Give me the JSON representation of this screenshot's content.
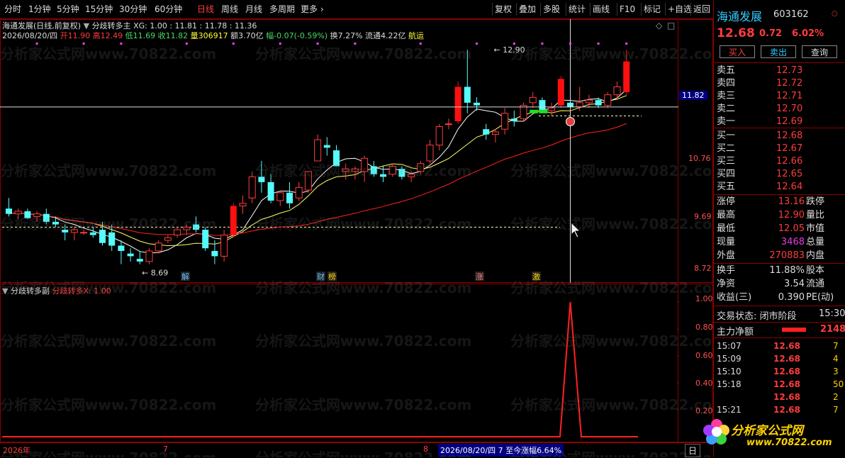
{
  "toolbar": {
    "left_items": [
      "分时",
      "1分钟",
      "5分钟",
      "15分钟",
      "30分钟",
      "60分钟",
      "日线",
      "周线",
      "月线",
      "多周期",
      "更多 ›"
    ],
    "active_index": 6,
    "right_items": [
      "复权",
      "叠加",
      "多股",
      "统计",
      "画线",
      "F10",
      "标记",
      "+自选",
      "返回"
    ]
  },
  "main_panel": {
    "stock_line": "海通发展(日线,前复权)",
    "indicator_name": "分歧转多主",
    "xg": "XG: 1.00 : 11.81 : 11.78 : 11.36",
    "detail_date": "2026/08/20/四",
    "detail_open": "开11.90",
    "detail_high": "高12.49",
    "detail_low": "低11.69",
    "detail_close": "收11.82",
    "detail_vol": "量306917",
    "detail_amt": "额3.70亿",
    "detail_chg": "幅-0.07(-0.59%)",
    "detail_turn": "换7.27%",
    "detail_float": "流通4.22亿",
    "detail_sector": "航运",
    "y_labels": [
      "11.82",
      "10.76",
      "9.69",
      "8.72"
    ],
    "high_mark": "12.90",
    "low_mark": "8.69",
    "event_tags": [
      "解",
      "财",
      "榜",
      "涨",
      "激"
    ]
  },
  "sub_panel": {
    "title": "分歧转多副",
    "value": "分歧转多X: 1.00",
    "y_labels": [
      "1.00",
      "0.80",
      "0.60",
      "0.40",
      "0.20"
    ]
  },
  "bottom_bar": {
    "year": "2026年",
    "m7": "7",
    "m8": "8",
    "status": "2026/08/20/四 7 至今涨幅6.64%",
    "period": "日"
  },
  "watermark": "分析家公式网www.70822.com",
  "right_panel": {
    "name": "海通发展",
    "code": "603162",
    "price": "12.68",
    "change": "0.72",
    "pct": "6.02%",
    "buy_btn": "买入",
    "sell_btn": "卖出",
    "query_btn": "查询",
    "asks": [
      [
        "卖五",
        "12.73"
      ],
      [
        "卖四",
        "12.72"
      ],
      [
        "卖三",
        "12.71"
      ],
      [
        "卖二",
        "12.70"
      ],
      [
        "卖一",
        "12.69"
      ]
    ],
    "bids": [
      [
        "买一",
        "12.68"
      ],
      [
        "买二",
        "12.67"
      ],
      [
        "买三",
        "12.66"
      ],
      [
        "买四",
        "12.65"
      ],
      [
        "买五",
        "12.64"
      ]
    ],
    "stats": [
      [
        "涨停",
        "13.16",
        "跌停"
      ],
      [
        "最高",
        "12.90",
        "量比"
      ],
      [
        "最低",
        "12.05",
        "市值"
      ],
      [
        "现量",
        "3468",
        "总量"
      ],
      [
        "外盘",
        "270883",
        "内盘"
      ]
    ],
    "stats2": [
      [
        "换手",
        "11.88%",
        "股本"
      ],
      [
        "净资",
        "3.54",
        "流通"
      ],
      [
        "收益(三)",
        "0.390",
        "PE(动)"
      ]
    ],
    "trade_state": "交易状态: 闭市阶段",
    "trade_time": "15:30",
    "net_label": "主力净额",
    "net_value": "2148",
    "ticks": [
      [
        "15:07",
        "12.68",
        "7"
      ],
      [
        "15:09",
        "12.68",
        "4"
      ],
      [
        "15:10",
        "12.68",
        "3"
      ],
      [
        "15:18",
        "12.68",
        "50"
      ],
      [
        "",
        "12.68",
        "2"
      ],
      [
        "15:21",
        "12.68",
        "7"
      ]
    ],
    "logo_text": "分析家公式网",
    "logo_url": "www.70822.com"
  },
  "chart_data": {
    "type": "candlestick",
    "candles": [
      [
        9.9,
        10.1,
        9.75,
        9.8
      ],
      [
        9.8,
        9.9,
        9.7,
        9.85
      ],
      [
        9.85,
        9.9,
        9.7,
        9.72
      ],
      [
        9.75,
        9.85,
        9.65,
        9.8
      ],
      [
        9.8,
        9.9,
        9.6,
        9.65
      ],
      [
        9.65,
        9.75,
        9.55,
        9.6
      ],
      [
        9.5,
        9.6,
        9.3,
        9.45
      ],
      [
        9.45,
        9.55,
        9.3,
        9.5
      ],
      [
        9.45,
        9.5,
        9.4,
        9.45
      ],
      [
        9.45,
        9.55,
        9.35,
        9.4
      ],
      [
        9.5,
        9.65,
        9.2,
        9.25
      ],
      [
        9.45,
        9.6,
        9.1,
        9.2
      ],
      [
        9.2,
        9.3,
        8.85,
        9.1
      ],
      [
        9.05,
        9.15,
        8.9,
        9.0
      ],
      [
        8.95,
        9.1,
        8.85,
        8.9
      ],
      [
        8.9,
        9.15,
        8.85,
        9.1
      ],
      [
        9.1,
        9.3,
        9.05,
        9.25
      ],
      [
        9.3,
        9.4,
        9.25,
        9.35
      ],
      [
        9.4,
        9.55,
        9.35,
        9.5
      ],
      [
        9.5,
        9.6,
        9.4,
        9.55
      ],
      [
        9.6,
        9.75,
        9.45,
        9.5
      ],
      [
        9.5,
        9.55,
        9.1,
        9.15
      ],
      [
        9.1,
        9.3,
        8.85,
        9.0
      ],
      [
        9.0,
        9.5,
        8.9,
        9.4
      ],
      [
        9.4,
        10.0,
        9.35,
        9.95
      ],
      [
        9.95,
        10.15,
        9.8,
        10.0
      ],
      [
        10.1,
        10.6,
        10.0,
        10.5
      ],
      [
        10.5,
        10.8,
        10.2,
        10.4
      ],
      [
        10.4,
        10.55,
        10.0,
        10.05
      ],
      [
        10.05,
        10.25,
        9.95,
        10.2
      ],
      [
        10.2,
        10.4,
        9.9,
        10.0
      ],
      [
        10.1,
        10.4,
        10.05,
        10.3
      ],
      [
        10.25,
        10.6,
        10.2,
        10.6
      ],
      [
        10.8,
        11.3,
        10.8,
        11.2
      ],
      [
        11.1,
        11.25,
        10.9,
        11.05
      ],
      [
        11.0,
        11.1,
        10.7,
        10.7
      ],
      [
        10.6,
        10.75,
        10.45,
        10.65
      ],
      [
        10.6,
        10.7,
        10.45,
        10.65
      ],
      [
        10.6,
        10.9,
        10.4,
        10.85
      ],
      [
        10.7,
        10.8,
        10.5,
        10.55
      ],
      [
        10.55,
        10.7,
        10.4,
        10.5
      ],
      [
        10.55,
        10.75,
        10.5,
        10.7
      ],
      [
        10.65,
        10.7,
        10.45,
        10.5
      ],
      [
        10.5,
        10.6,
        10.4,
        10.55
      ],
      [
        10.6,
        10.8,
        10.55,
        10.75
      ],
      [
        10.8,
        11.2,
        10.75,
        11.1
      ],
      [
        11.1,
        11.5,
        11.0,
        11.45
      ],
      [
        11.5,
        11.6,
        11.4,
        11.5
      ],
      [
        11.55,
        12.3,
        11.5,
        12.2
      ],
      [
        12.2,
        12.9,
        11.7,
        11.9
      ],
      [
        11.9,
        12.0,
        11.75,
        11.85
      ],
      [
        11.4,
        11.5,
        11.2,
        11.3
      ],
      [
        11.3,
        11.4,
        11.15,
        11.35
      ],
      [
        11.4,
        11.8,
        11.3,
        11.7
      ],
      [
        11.6,
        11.75,
        11.45,
        11.55
      ],
      [
        11.6,
        11.9,
        11.55,
        11.85
      ],
      [
        11.9,
        12.1,
        11.8,
        12.0
      ],
      [
        11.95,
        12.0,
        11.7,
        11.75
      ],
      [
        11.75,
        11.9,
        11.65,
        11.8
      ],
      [
        11.85,
        12.4,
        11.8,
        12.35
      ],
      [
        11.9,
        12.49,
        11.69,
        11.82
      ],
      [
        11.82,
        12.2,
        11.75,
        11.9
      ],
      [
        11.9,
        12.05,
        11.8,
        11.95
      ],
      [
        11.95,
        12.0,
        11.8,
        11.85
      ],
      [
        11.85,
        12.1,
        11.8,
        12.05
      ],
      [
        12.05,
        12.3,
        11.95,
        12.2
      ],
      [
        12.1,
        12.9,
        12.05,
        12.68
      ]
    ]
  }
}
